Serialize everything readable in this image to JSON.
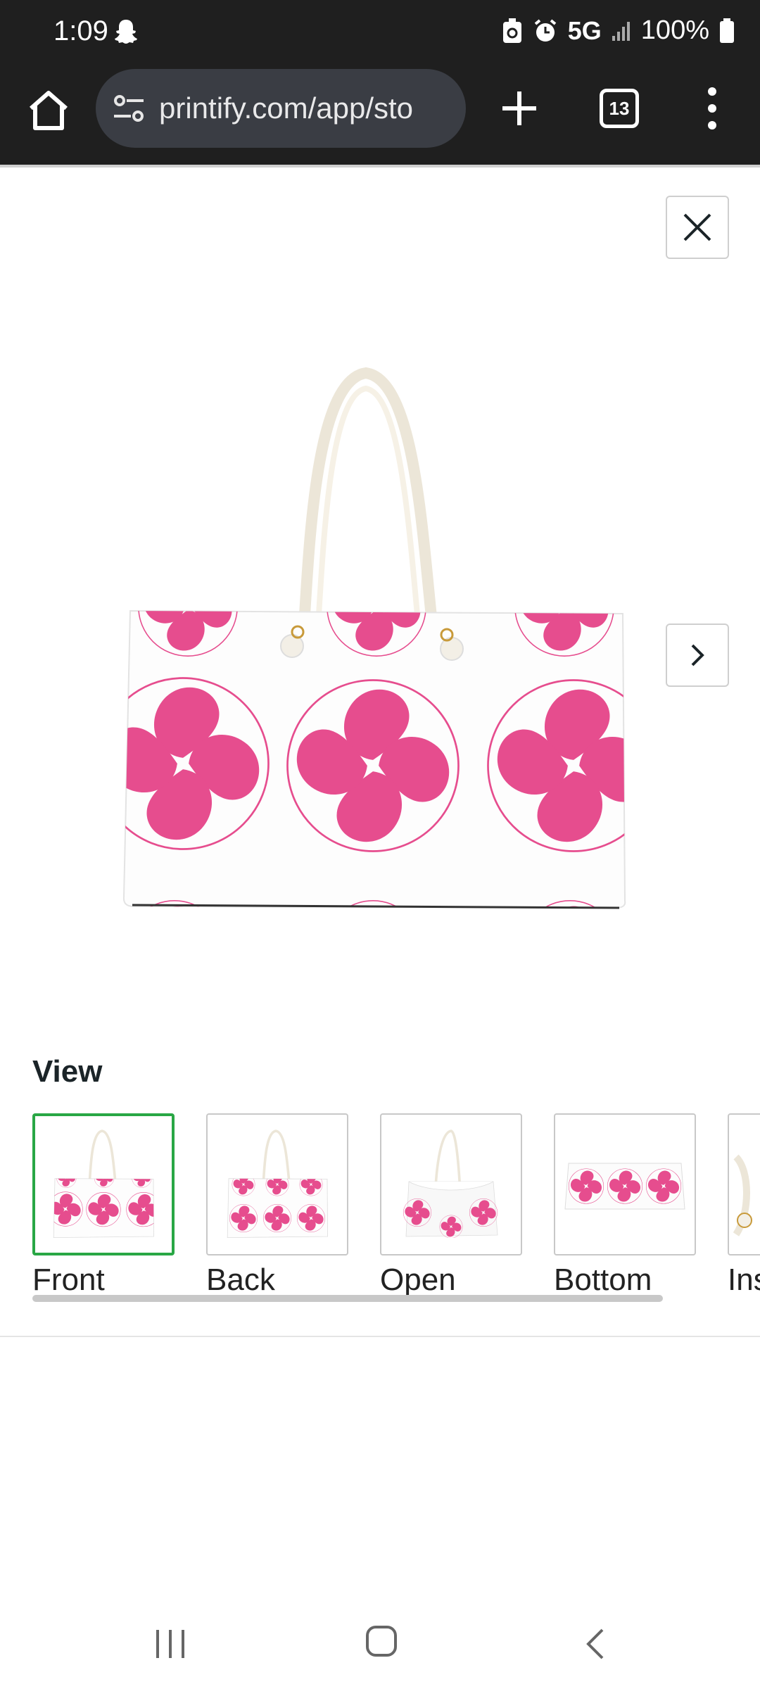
{
  "status_bar": {
    "time": "1:09",
    "network": "5G",
    "battery": "100%",
    "icons": [
      "snapchat-ghost-icon",
      "recycle-icon",
      "alarm-icon",
      "signal-icon",
      "battery-icon"
    ]
  },
  "browser": {
    "url": "printify.com/app/sto",
    "tab_count": "13",
    "icons": [
      "home-icon",
      "site-settings-icon",
      "new-tab-plus-icon",
      "tabs-icon",
      "more-menu-icon"
    ]
  },
  "viewer": {
    "icons": [
      "close-icon",
      "chevron-right-icon"
    ],
    "colors": {
      "pattern_pink": "#e64d8e",
      "active_border": "#29a745"
    }
  },
  "view_section": {
    "title": "View",
    "thumbnails": [
      {
        "label": "Front",
        "active": true
      },
      {
        "label": "Back",
        "active": false
      },
      {
        "label": "Open",
        "active": false
      },
      {
        "label": "Bottom",
        "active": false
      },
      {
        "label": "Ins",
        "active": false
      }
    ]
  },
  "nav_bar": {
    "icons": [
      "recents-icon",
      "home-circle-icon",
      "back-icon"
    ]
  }
}
